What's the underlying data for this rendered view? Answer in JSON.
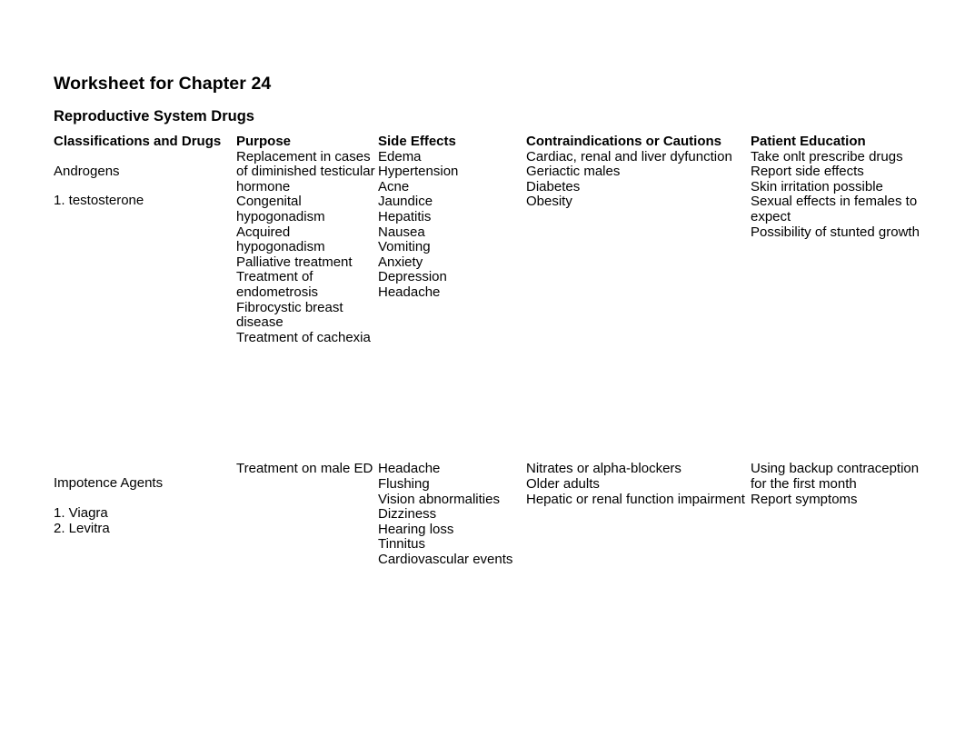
{
  "document": {
    "title": "Worksheet for Chapter 24",
    "section_title": "Reproductive System Drugs"
  },
  "table": {
    "headers": [
      "Classifications and Drugs",
      "Purpose",
      "Side Effects",
      "Contraindications or Cautions",
      "Patient Education"
    ],
    "rows": [
      {
        "classification": "Androgens",
        "drugs": "1. testosterone",
        "purpose": "Replacement in cases of diminished testicular hormone\nCongenital hypogonadism\nAcquired hypogonadism\nPalliative treatment\nTreatment of endometrosis\nFibrocystic breast disease\nTreatment of cachexia",
        "side_effects": "Edema\nHypertension\nAcne\nJaundice\nHepatitis\nNausea\nVomiting\nAnxiety\nDepression\nHeadache",
        "contraindications": "Cardiac, renal and liver dyfunction\nGeriactic males\nDiabetes\nObesity",
        "education": "Take onlt prescribe drugs\nReport side effects\nSkin irritation possible\nSexual effects in females to expect\nPossibility of stunted growth"
      },
      {
        "classification": "Impotence Agents",
        "drugs": "1. Viagra\n2. Levitra",
        "purpose": "Treatment on male ED",
        "side_effects": "Headache\nFlushing\nVision abnormalities\nDizziness\nHearing loss\nTinnitus\nCardiovascular events",
        "contraindications": "Nitrates or alpha-blockers\nOlder adults\nHepatic or renal function impairment",
        "education": "Using backup contraception for the first month\nReport symptoms"
      }
    ]
  }
}
